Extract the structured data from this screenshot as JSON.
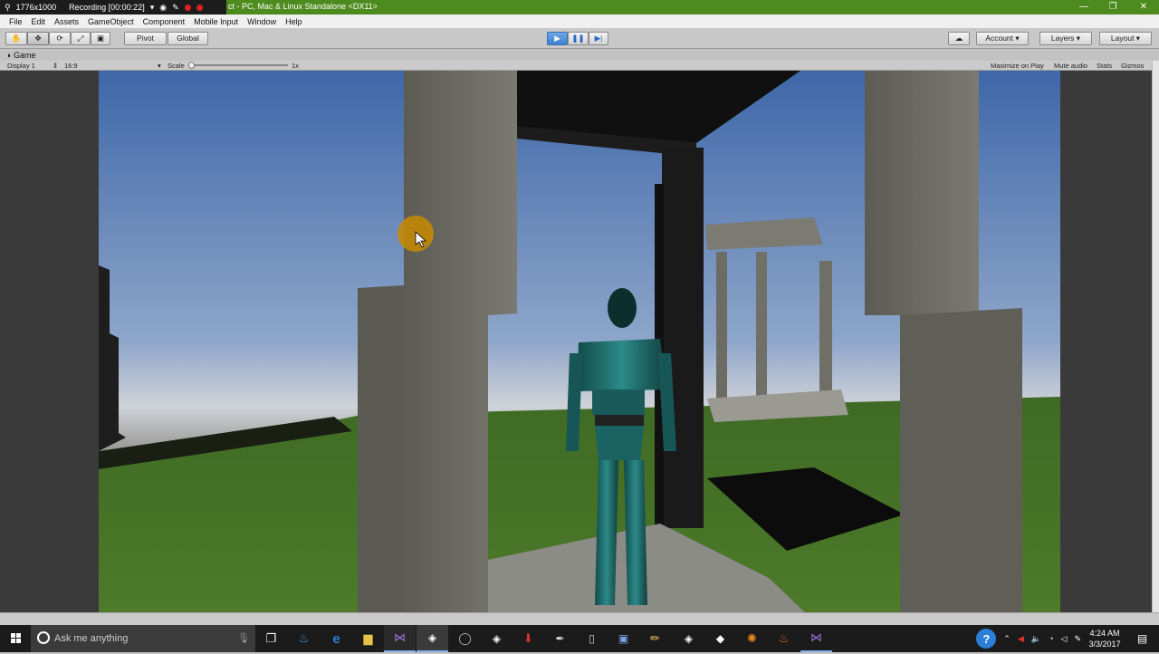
{
  "recorder": {
    "resolution": "1776x1000",
    "recording": "Recording [00:00:22]"
  },
  "window": {
    "title_visible": "ct - PC, Mac & Linux Standalone <DX11>",
    "minimize": "—",
    "maximize": "❐",
    "close": "✕"
  },
  "menu": [
    "File",
    "Edit",
    "Assets",
    "GameObject",
    "Component",
    "Mobile Input",
    "Window",
    "Help"
  ],
  "toolbar": {
    "pivot": "Pivot",
    "global": "Global",
    "account": "Account",
    "layers": "Layers",
    "layout": "Layout"
  },
  "game_tab": {
    "label": "Game",
    "display": "Display 1",
    "aspect": "16:9",
    "scale_label": "Scale",
    "scale_value": "1x",
    "maximize_on_play": "Maximize on Play",
    "mute_audio": "Mute audio",
    "stats": "Stats",
    "gizmos": "Gizmos"
  },
  "taskbar": {
    "search_placeholder": "Ask me anything",
    "time": "4:24 AM",
    "date": "3/3/2017"
  },
  "colors": {
    "title_bar": "#4e8b1e",
    "play_active": "#3d7fd2",
    "sky_top": "#4a73b4",
    "sky_horizon": "#c9ccd4",
    "grass": "#3d6a22",
    "stone": "#6a6a62",
    "character": "#1f6f6e",
    "cursor_highlight": "#c88a00"
  }
}
